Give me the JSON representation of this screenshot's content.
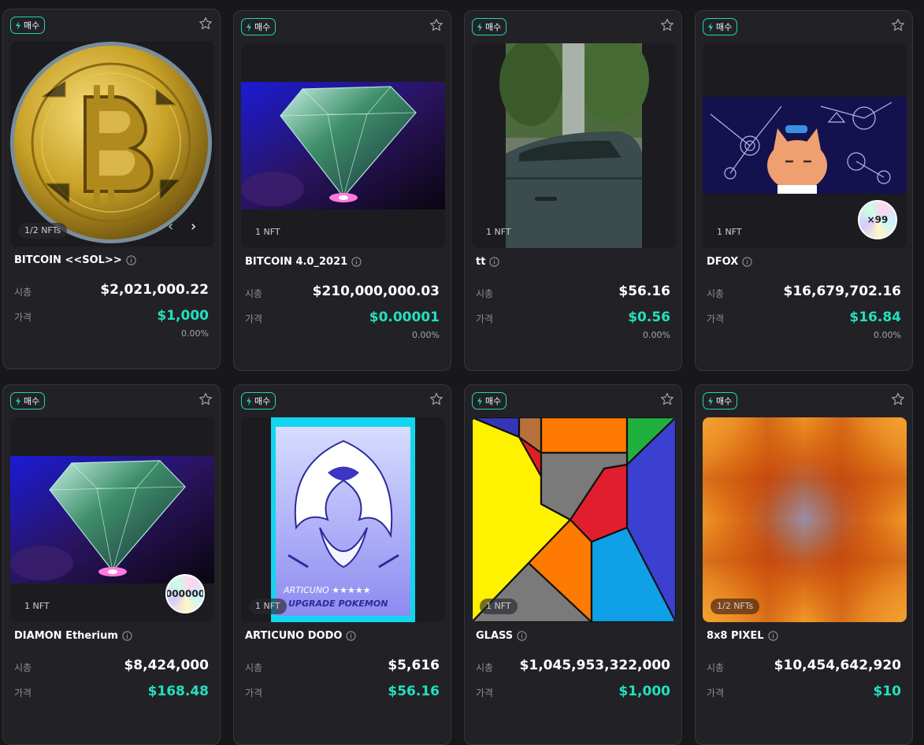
{
  "ui": {
    "buy_label": "매수",
    "market_cap_label": "시총",
    "price_label": "가격"
  },
  "cards": [
    {
      "name": "BITCOIN <<SOL>>",
      "nft_count": "1/2 NFTs",
      "market_cap": "$2,021,000.22",
      "price": "$1,000",
      "change": "0.00%"
    },
    {
      "name": "BITCOIN 4.0_2021",
      "nft_count": "1 NFT",
      "market_cap": "$210,000,000.03",
      "price": "$0.00001",
      "change": "0.00%"
    },
    {
      "name": "tt",
      "nft_count": "1 NFT",
      "market_cap": "$56.16",
      "price": "$0.56",
      "change": "0.00%"
    },
    {
      "name": "DFOX",
      "nft_count": "1 NFT",
      "market_cap": "$16,679,702.16",
      "price": "$16.84",
      "change": "0.00%",
      "badge": "×99"
    },
    {
      "name": "DIAMON Etherium",
      "nft_count": "1 NFT",
      "market_cap": "$8,424,000",
      "price": "$168.48",
      "badge": "000000"
    },
    {
      "name": "ARTICUNO DODO",
      "nft_count": "1 NFT",
      "market_cap": "$5,616",
      "price": "$56.16",
      "art_text_1": "ARTICUNO ★★★★★",
      "art_text_2": "UPGRADE POKEMON"
    },
    {
      "name": "GLASS",
      "nft_count": "1 NFT",
      "market_cap": "$1,045,953,322,000",
      "price": "$1,000"
    },
    {
      "name": "8x8 PIXEL",
      "nft_count": "1/2 NFTs",
      "market_cap": "$10,454,642,920",
      "price": "$10"
    }
  ],
  "icons": {
    "bolt": "lightning-icon",
    "star": "star-icon",
    "info": "info-icon",
    "prev": "chevron-left-icon",
    "next": "chevron-right-icon"
  },
  "colors": {
    "accent": "#22d3b4",
    "price": "#22e0bf",
    "card_bg": "#222226",
    "page_bg": "#18181b"
  }
}
